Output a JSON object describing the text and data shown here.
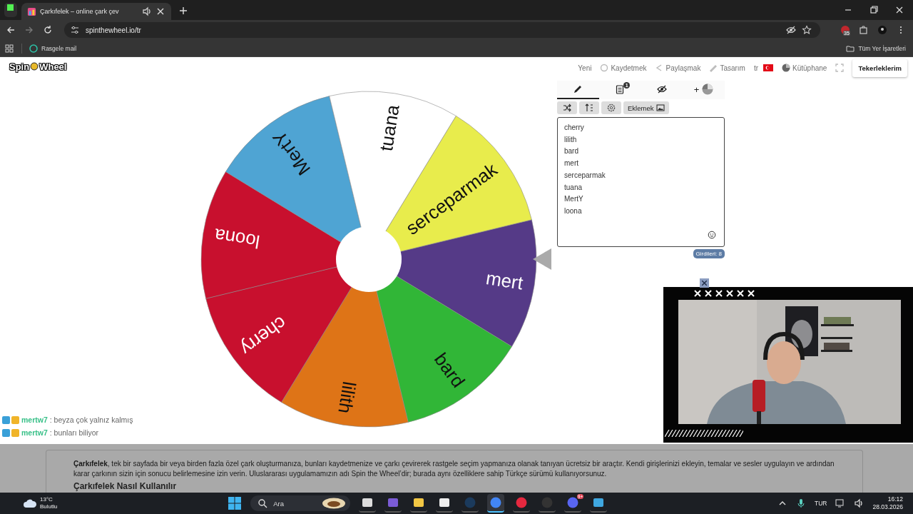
{
  "browser": {
    "tab_title": "Çarkıfelek – online çark çev",
    "address": "spinthewheel.io/tr",
    "bookmark": "Rasgele mail",
    "all_bookmarks": "Tüm Yer İşaretleri",
    "extension_badge": "35"
  },
  "site": {
    "logo": [
      "Spin",
      "Wheel"
    ],
    "nav": [
      {
        "label": "Yeni",
        "kind": "text"
      },
      {
        "label": "Kaydetmek",
        "kind": "save"
      },
      {
        "label": "Paylaşmak",
        "kind": "share"
      },
      {
        "label": "Tasarım",
        "kind": "design"
      },
      {
        "label": "tr",
        "kind": "language"
      },
      {
        "label": "Kütüphane",
        "kind": "library"
      },
      {
        "kind": "fullscreen"
      }
    ],
    "my_wheels": "Tekerleklerim"
  },
  "wheel": {
    "slices": [
      {
        "label": "mert",
        "color": "#553a87"
      },
      {
        "label": "bard",
        "color": "#31b637"
      },
      {
        "label": "lilith",
        "color": "#de7417"
      },
      {
        "label": "cherry",
        "color": "#c8102e"
      },
      {
        "label": "loona",
        "color": "#c8102e"
      },
      {
        "label": "MertY",
        "color": "#4fa4d3"
      },
      {
        "label": "tuana",
        "color": "#ffffff"
      },
      {
        "label": "serceparmak",
        "color": "#e8ec4c"
      }
    ]
  },
  "editor": {
    "tabs": [
      {
        "kind": "edit",
        "selected": true
      },
      {
        "kind": "results",
        "selected": false,
        "badge": "1"
      },
      {
        "kind": "hide",
        "selected": false
      },
      {
        "kind": "add",
        "selected": false,
        "label": "+"
      }
    ],
    "tools": [
      {
        "kind": "shuffle"
      },
      {
        "kind": "sort"
      },
      {
        "kind": "settings"
      },
      {
        "kind": "add-image",
        "label": "Eklemek"
      }
    ],
    "entries": [
      "cherry",
      "lilith",
      "bard",
      "mert",
      "serceparmak",
      "tuana",
      "MertY",
      "loona"
    ],
    "count": "Girdileri: 8"
  },
  "chat": [
    {
      "user": "mertw7",
      "message": ": beyza çok yalnız kalmış"
    },
    {
      "user": "mertw7",
      "message": ": bunları biliyor"
    }
  ],
  "article": {
    "paragraph": "**Çarkıfelek**, tek bir sayfada bir veya birden fazla özel çark oluşturmanıza, bunları kaydetmenize ve çarkı çevirerek rastgele seçim yapmanıza olanak tanıyan ücretsiz bir araçtır. Kendi girişlerinizi ekleyin, temalar ve sesler uygulayın ve ardından karar çarkının sizin için sonucu belirlemesine izin verin. Uluslararası uygulamamızın adı Spin the Wheel’dir; burada aynı özelliklere sahip Türkçe sürümü kullanıyorsunuz.",
    "heading": "Çarkıfelek Nasıl Kullanılır"
  },
  "taskbar": {
    "temperature": "13°C",
    "weather": "Bulutlu",
    "search_placeholder": "Ara",
    "apps": [
      {
        "kind": "taskview",
        "active": false
      },
      {
        "kind": "office",
        "active": false
      },
      {
        "kind": "files",
        "active": false
      },
      {
        "kind": "store",
        "active": false
      },
      {
        "kind": "steam",
        "active": false
      },
      {
        "kind": "browser",
        "active": true
      },
      {
        "kind": "music",
        "active": false
      },
      {
        "kind": "recorder",
        "active": false
      },
      {
        "kind": "chat",
        "active": false,
        "badge": "9+"
      },
      {
        "kind": "notes",
        "active": false
      }
    ],
    "language": "TUR",
    "time": "16:12",
    "date": "28.03.2026"
  }
}
